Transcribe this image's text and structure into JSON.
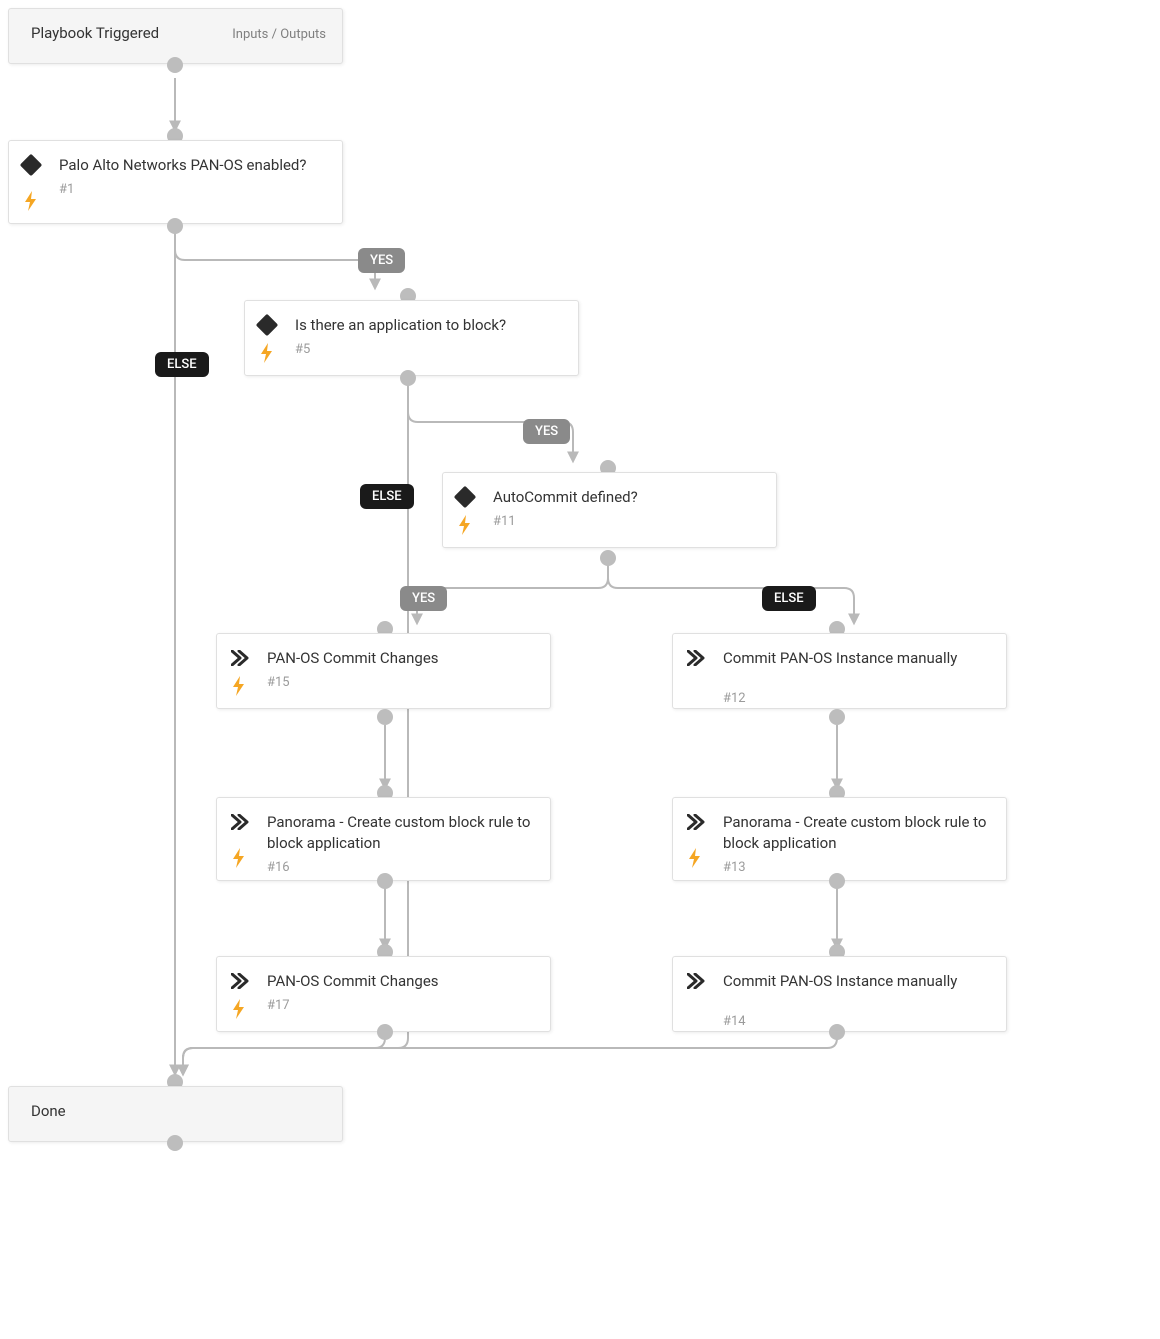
{
  "start": {
    "title": "Playbook Triggered",
    "io": "Inputs / Outputs"
  },
  "n1": {
    "title": "Palo Alto Networks PAN-OS enabled?",
    "id": "#1"
  },
  "n5": {
    "title": "Is there an application to block?",
    "id": "#5"
  },
  "n11": {
    "title": "AutoCommit defined?",
    "id": "#11"
  },
  "n15": {
    "title": "PAN-OS Commit Changes",
    "id": "#15"
  },
  "n12": {
    "title": "Commit PAN-OS Instance manually",
    "id": "#12"
  },
  "n16": {
    "title": "Panorama - Create custom block rule to block application",
    "id": "#16"
  },
  "n13": {
    "title": "Panorama - Create custom block rule to block application",
    "id": "#13"
  },
  "n17": {
    "title": "PAN-OS Commit Changes",
    "id": "#17"
  },
  "n14": {
    "title": "Commit PAN-OS Instance manually",
    "id": "#14"
  },
  "done": {
    "title": "Done"
  },
  "labels": {
    "yes": "YES",
    "else": "ELSE"
  }
}
